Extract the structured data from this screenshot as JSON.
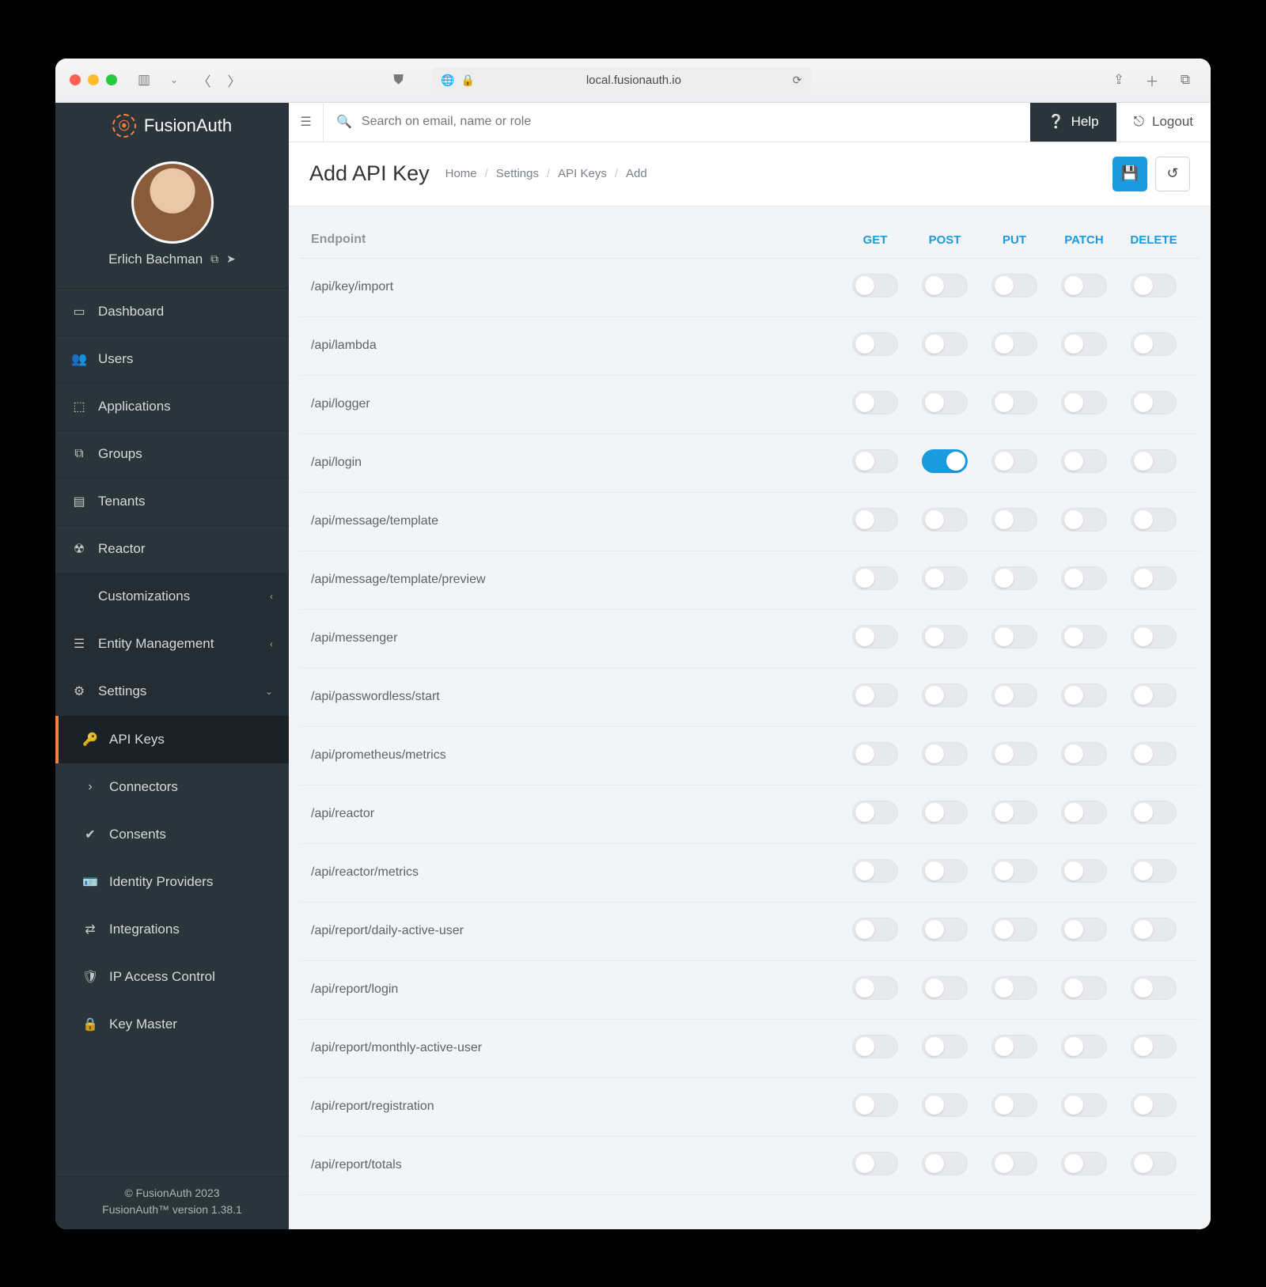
{
  "browser": {
    "url": "local.fusionauth.io"
  },
  "brand": "FusionAuth",
  "user": {
    "name": "Erlich Bachman"
  },
  "search": {
    "placeholder": "Search on email, name or role"
  },
  "help_label": "Help",
  "logout_label": "Logout",
  "nav": {
    "items": [
      {
        "label": "Dashboard",
        "icon": "▭"
      },
      {
        "label": "Users",
        "icon": "👥"
      },
      {
        "label": "Applications",
        "icon": "⬚"
      },
      {
        "label": "Groups",
        "icon": "⧉"
      },
      {
        "label": "Tenants",
        "icon": "▤"
      },
      {
        "label": "Reactor",
        "icon": "☢"
      }
    ],
    "sections": [
      {
        "label": "Customizations",
        "icon": "</>",
        "expanded": false
      },
      {
        "label": "Entity Management",
        "icon": "☰",
        "expanded": false
      },
      {
        "label": "Settings",
        "icon": "⚙",
        "expanded": true,
        "children": [
          {
            "label": "API Keys",
            "icon": "🔑",
            "active": true
          },
          {
            "label": "Connectors",
            "icon": "›"
          },
          {
            "label": "Consents",
            "icon": "✔"
          },
          {
            "label": "Identity Providers",
            "icon": "🪪"
          },
          {
            "label": "Integrations",
            "icon": "⇄"
          },
          {
            "label": "IP Access Control",
            "icon": "🛡"
          },
          {
            "label": "Key Master",
            "icon": "🔒"
          }
        ]
      }
    ]
  },
  "footer": {
    "copyright": "© FusionAuth 2023",
    "version": "FusionAuth™ version 1.38.1"
  },
  "page": {
    "title": "Add API Key",
    "breadcrumbs": [
      "Home",
      "Settings",
      "API Keys",
      "Add"
    ],
    "columns": {
      "endpoint": "Endpoint",
      "methods": [
        "GET",
        "POST",
        "PUT",
        "PATCH",
        "DELETE"
      ]
    },
    "rows": [
      {
        "endpoint": "/api/key/import",
        "on": []
      },
      {
        "endpoint": "/api/lambda",
        "on": []
      },
      {
        "endpoint": "/api/logger",
        "on": []
      },
      {
        "endpoint": "/api/login",
        "on": [
          "POST"
        ]
      },
      {
        "endpoint": "/api/message/template",
        "on": []
      },
      {
        "endpoint": "/api/message/template/preview",
        "on": []
      },
      {
        "endpoint": "/api/messenger",
        "on": []
      },
      {
        "endpoint": "/api/passwordless/start",
        "on": []
      },
      {
        "endpoint": "/api/prometheus/metrics",
        "on": []
      },
      {
        "endpoint": "/api/reactor",
        "on": []
      },
      {
        "endpoint": "/api/reactor/metrics",
        "on": []
      },
      {
        "endpoint": "/api/report/daily-active-user",
        "on": []
      },
      {
        "endpoint": "/api/report/login",
        "on": []
      },
      {
        "endpoint": "/api/report/monthly-active-user",
        "on": []
      },
      {
        "endpoint": "/api/report/registration",
        "on": []
      },
      {
        "endpoint": "/api/report/totals",
        "on": []
      }
    ]
  }
}
